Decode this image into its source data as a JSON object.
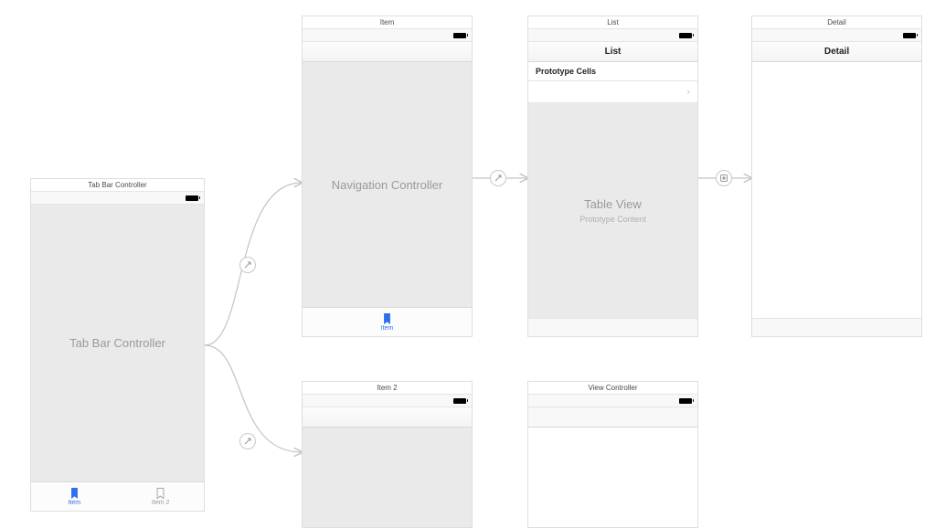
{
  "scenes": {
    "tabbar": {
      "title": "Tab Bar Controller",
      "placeholder": "Tab Bar Controller",
      "tabs": [
        {
          "label": "Item",
          "active": true
        },
        {
          "label": "Item 2",
          "active": false
        }
      ]
    },
    "navItem": {
      "title": "Item",
      "placeholder": "Navigation Controller",
      "tab": {
        "label": "Item"
      }
    },
    "list": {
      "title": "List",
      "navTitle": "List",
      "sectionHeader": "Prototype Cells",
      "tablePlaceholder": "Table View",
      "tableSub": "Prototype Content"
    },
    "detail": {
      "title": "Detail",
      "navTitle": "Detail"
    },
    "item2": {
      "title": "Item 2"
    },
    "viewController": {
      "title": "View Controller"
    }
  },
  "colors": {
    "tint": "#2f6fea",
    "gray": "#9a9a9a"
  }
}
